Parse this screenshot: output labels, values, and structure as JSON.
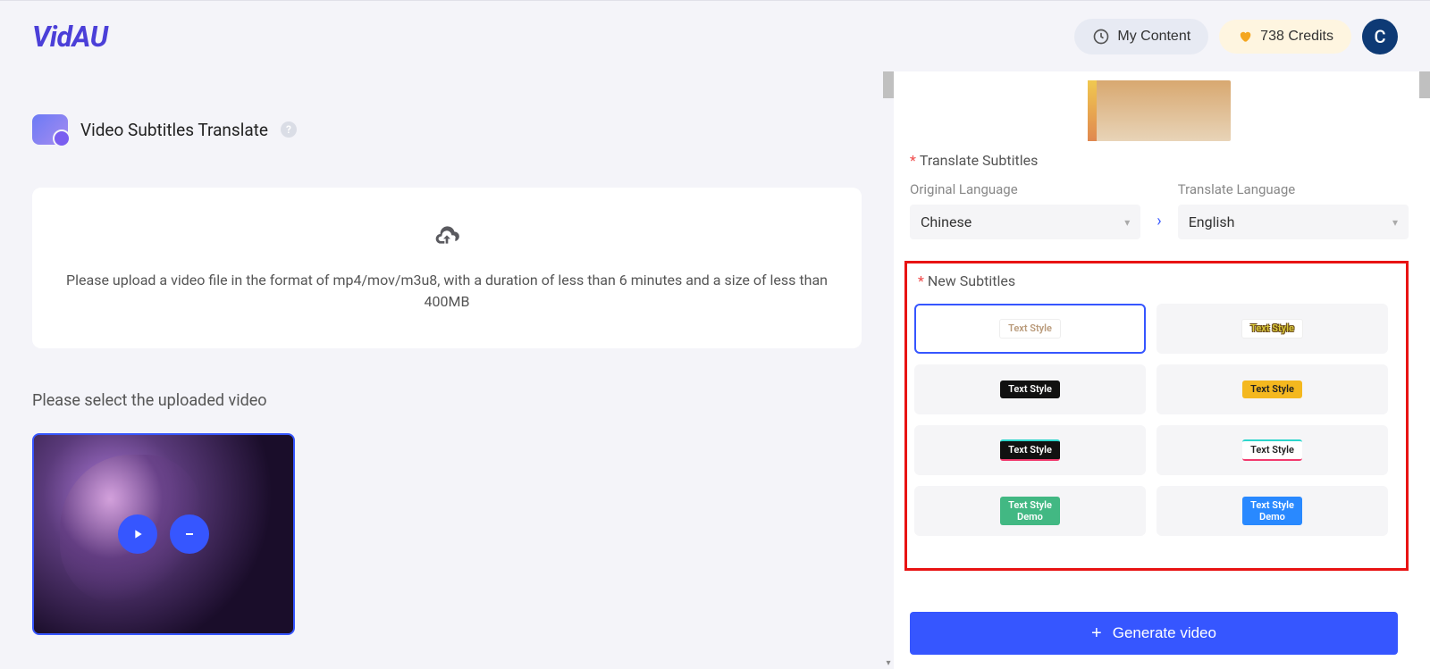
{
  "brand": "VidAU",
  "header": {
    "myContent": "My Content",
    "creditsText": "738 Credits",
    "avatarLetter": "C"
  },
  "page": {
    "title": "Video Subtitles Translate",
    "uploadHint": "Please upload a video file in the format of mp4/mov/m3u8, with a duration of less than 6 minutes and a size of less than 400MB",
    "selectVideoLabel": "Please select the uploaded video"
  },
  "sidebar": {
    "translateLabel": "Translate Subtitles",
    "originalLangLabel": "Original Language",
    "translateLangLabel": "Translate Language",
    "originalLang": "Chinese",
    "translateLang": "English",
    "newSubtitlesLabel": "New Subtitles",
    "styles": [
      {
        "text": "Text Style"
      },
      {
        "text": "Text Style"
      },
      {
        "text": "Text Style"
      },
      {
        "text": "Text Style"
      },
      {
        "text": "Text Style"
      },
      {
        "text": "Text Style"
      },
      {
        "text": "Text Style\nDemo"
      },
      {
        "text": "Text Style\nDemo"
      }
    ],
    "generateLabel": "Generate video"
  }
}
